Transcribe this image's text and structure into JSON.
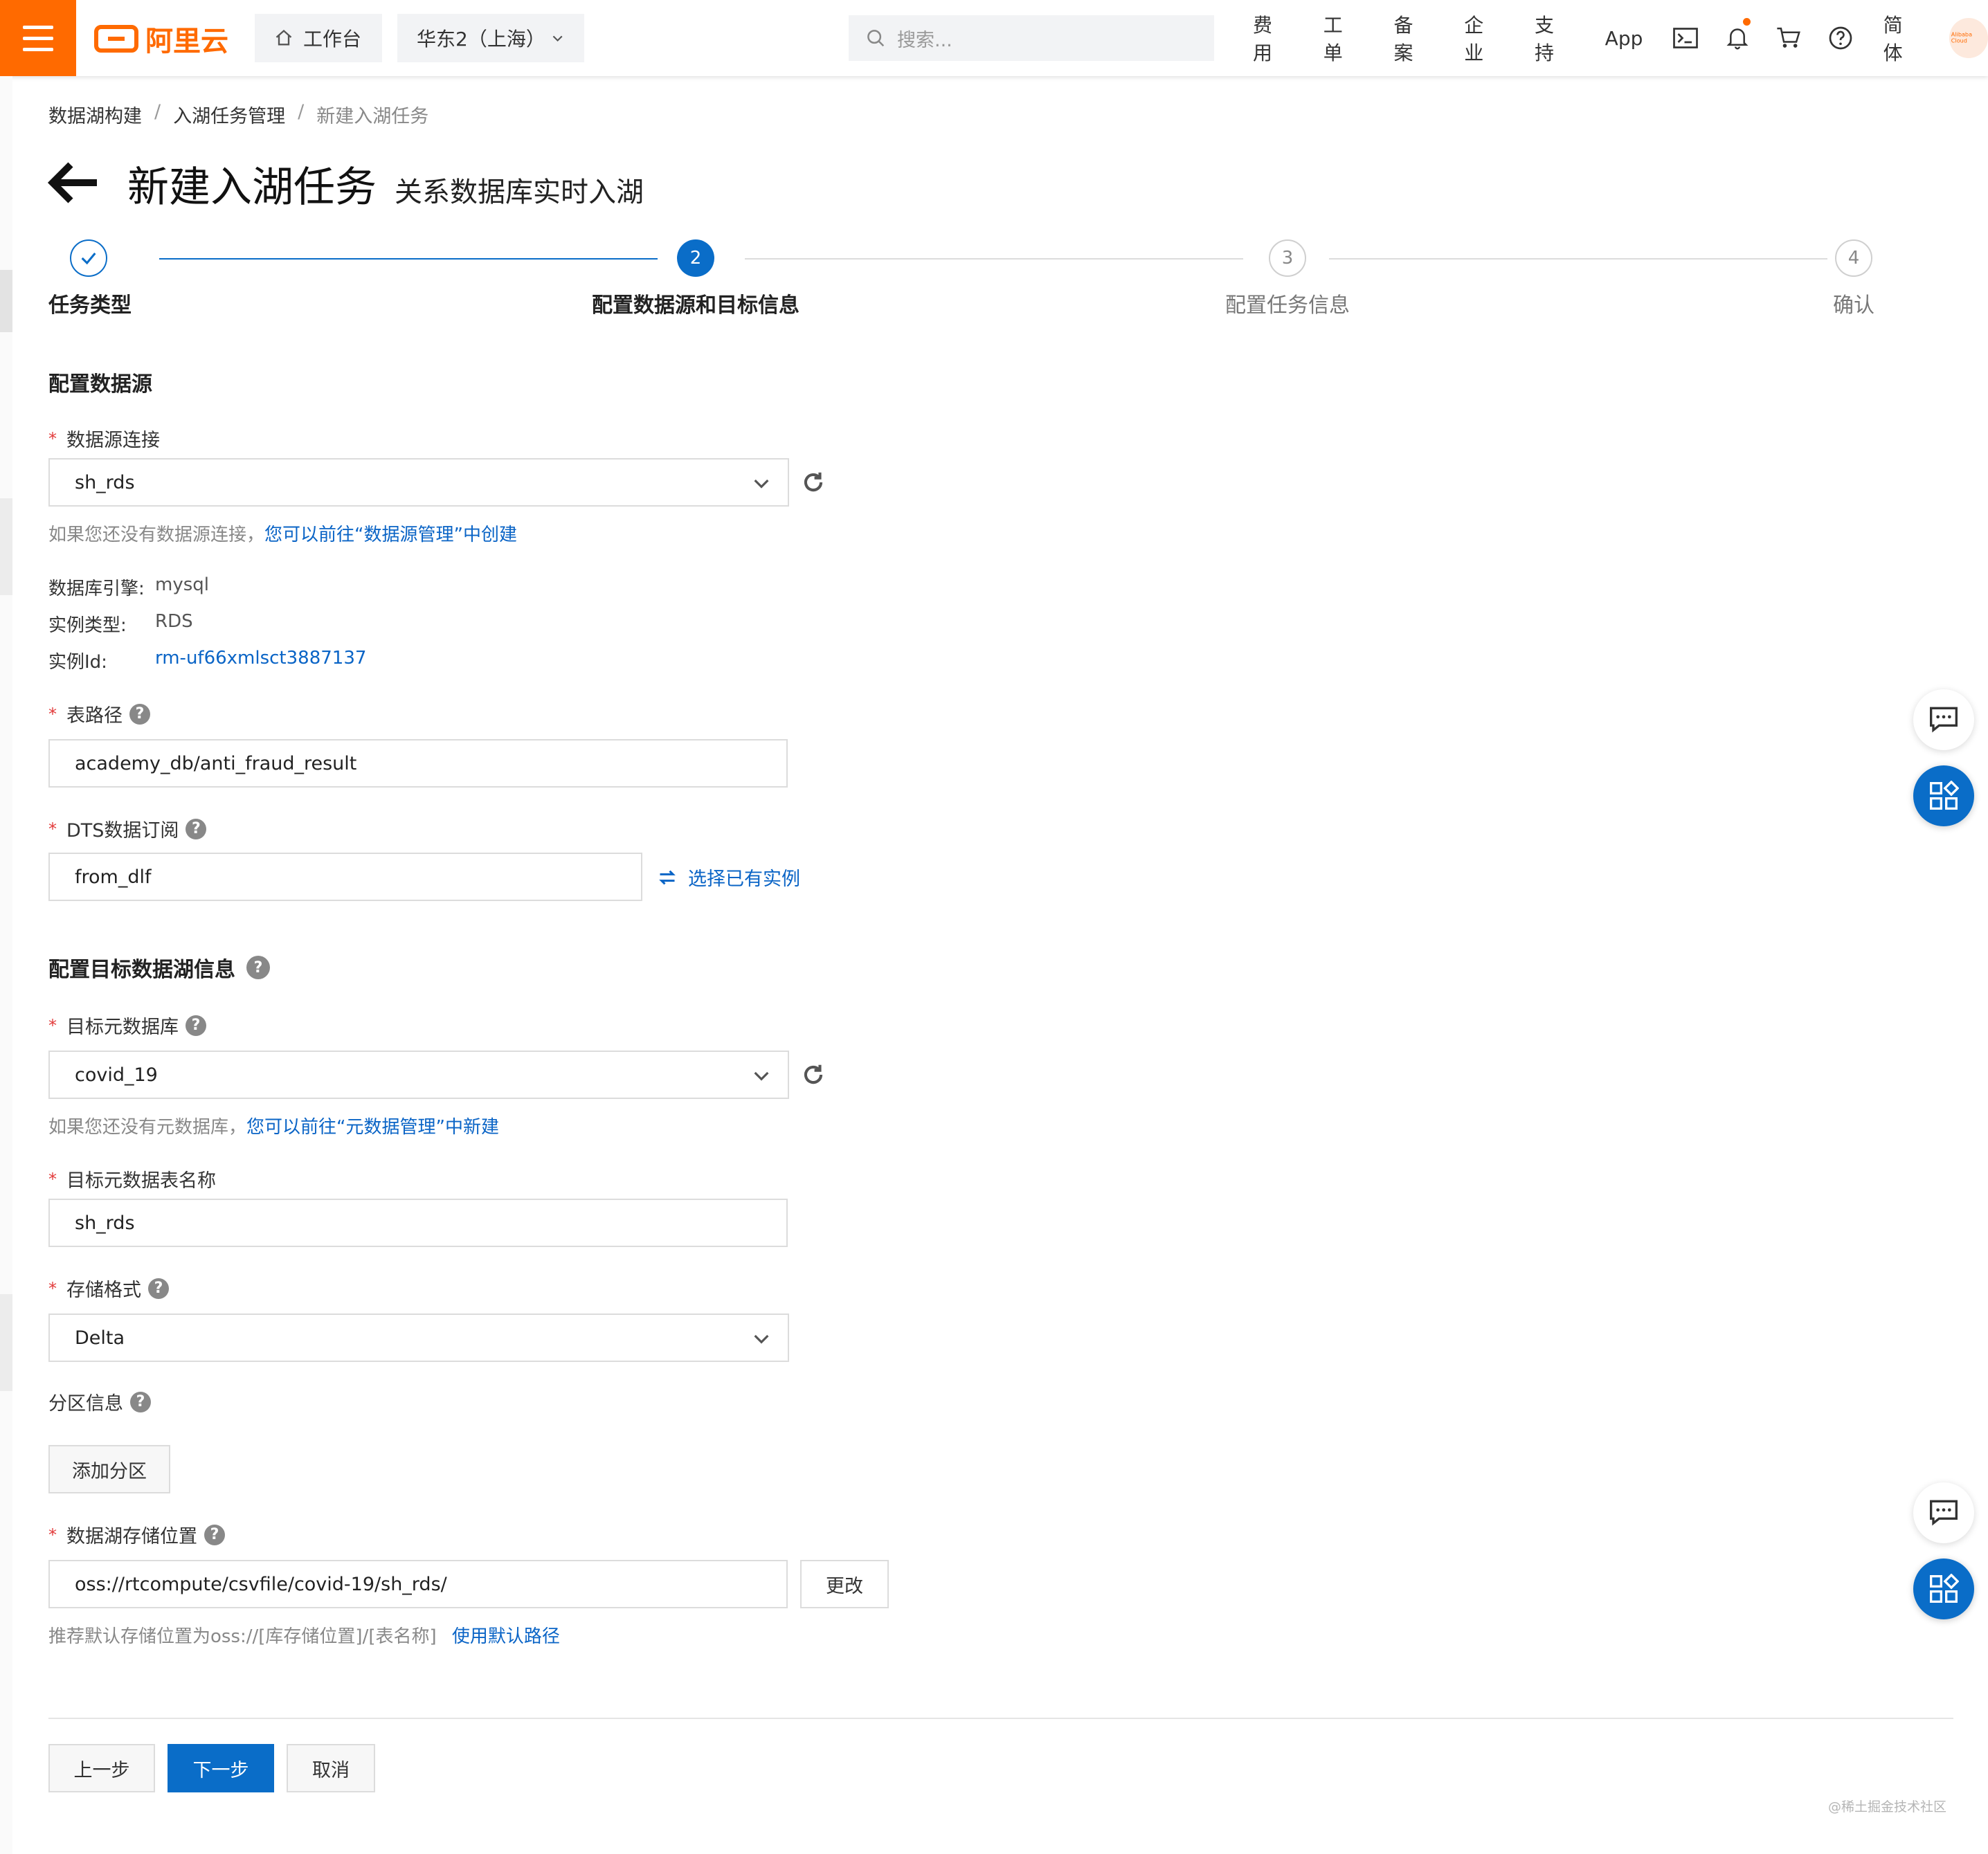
{
  "topbar": {
    "logo_text": "阿里云",
    "workbench": "工作台",
    "region": "华东2（上海）",
    "search_placeholder": "搜索...",
    "nav": [
      "费用",
      "工单",
      "备案",
      "企业",
      "支持",
      "App"
    ],
    "lang": "简体",
    "avatar_text": "Alibaba Cloud",
    "accent": "#ff6a00"
  },
  "breadcrumb": [
    "数据湖构建",
    "入湖任务管理",
    "新建入湖任务"
  ],
  "page": {
    "title": "新建入湖任务",
    "subtitle": "关系数据库实时入湖"
  },
  "steps": [
    {
      "num": "1",
      "label": "任务类型",
      "state": "done"
    },
    {
      "num": "2",
      "label": "配置数据源和目标信息",
      "state": "active"
    },
    {
      "num": "3",
      "label": "配置任务信息",
      "state": "pending"
    },
    {
      "num": "4",
      "label": "确认",
      "state": "pending"
    }
  ],
  "source": {
    "section_title": "配置数据源",
    "conn_label": "数据源连接",
    "conn_value": "sh_rds",
    "conn_hint": "如果您还没有数据源连接，",
    "conn_hint_link": "您可以前往“数据源管理”中创建",
    "engine_k": "数据库引擎:",
    "engine_v": "mysql",
    "type_k": "实例类型:",
    "type_v": "RDS",
    "id_k": "实例Id:",
    "id_v": "rm-uf66xmlsct3887137",
    "table_label": "表路径",
    "table_value": "academy_db/anti_fraud_result",
    "dts_label": "DTS数据订阅",
    "dts_value": "from_dlf",
    "dts_link": "选择已有实例"
  },
  "target": {
    "section_title": "配置目标数据湖信息",
    "db_label": "目标元数据库",
    "db_value": "covid_19",
    "db_hint": "如果您还没有元数据库，",
    "db_hint_link": "您可以前往“元数据管理”中新建",
    "tbl_label": "目标元数据表名称",
    "tbl_value": "sh_rds",
    "fmt_label": "存储格式",
    "fmt_value": "Delta",
    "part_label": "分区信息",
    "part_button": "添加分区",
    "loc_label": "数据湖存储位置",
    "loc_value": "oss://rtcompute/csvfile/covid-19/sh_rds/",
    "loc_button": "更改",
    "loc_hint": "推荐默认存储位置为oss://[库存储位置]/[表名称]",
    "loc_hint_link": "使用默认路径"
  },
  "footer": {
    "prev": "上一步",
    "next": "下一步",
    "cancel": "取消",
    "watermark": "@稀土掘金技术社区"
  }
}
